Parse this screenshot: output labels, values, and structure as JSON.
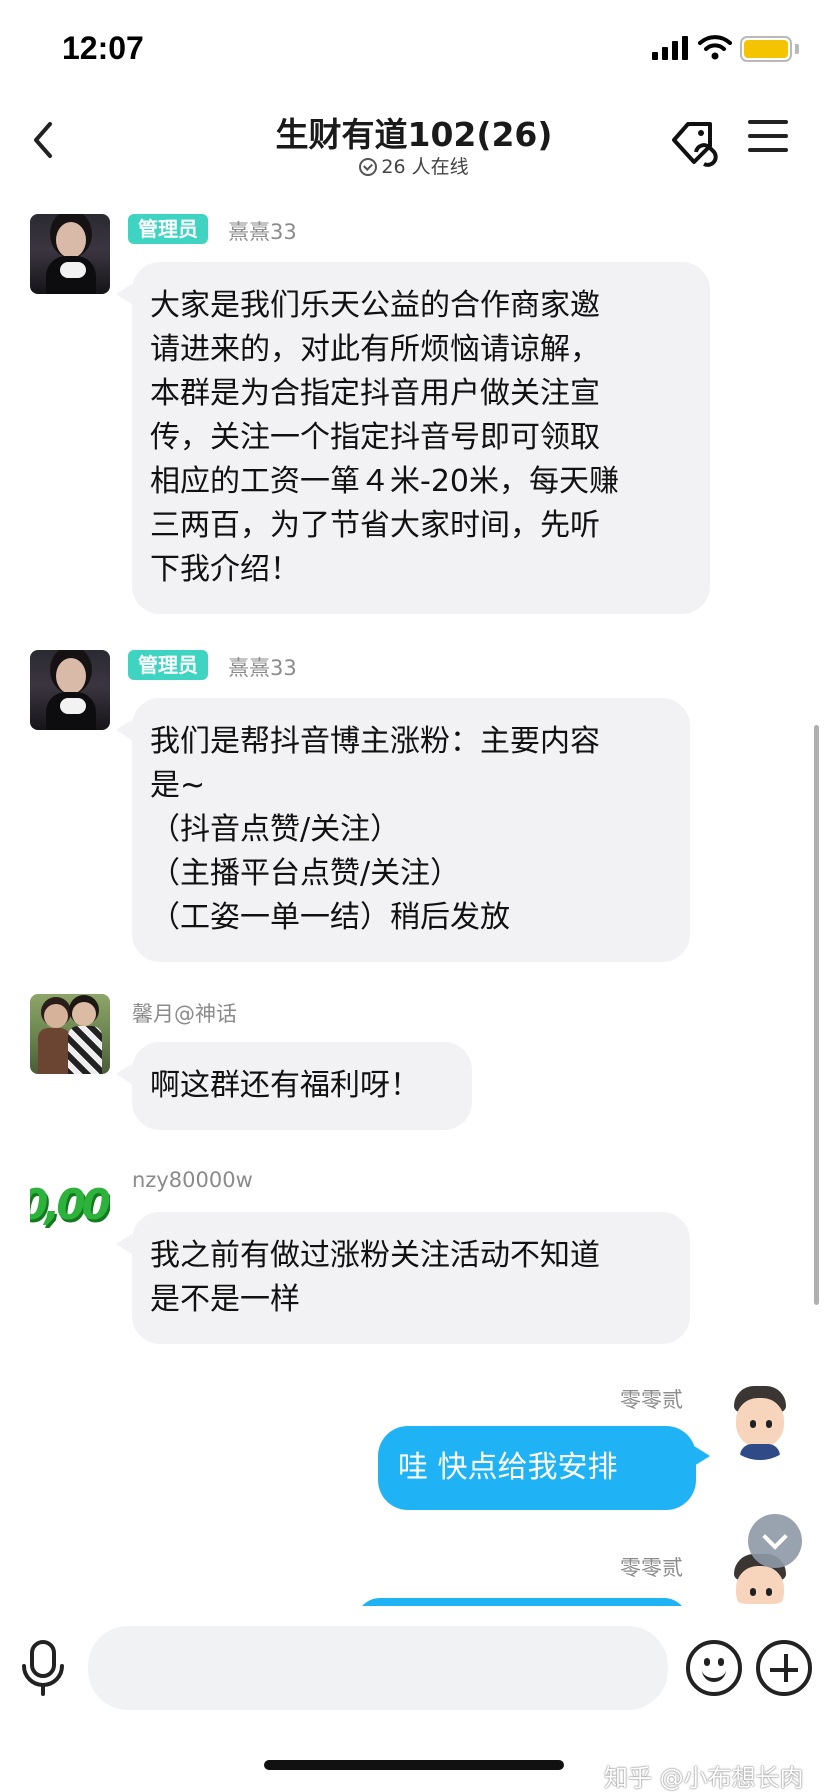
{
  "status_bar": {
    "time": "12:07",
    "battery_color": "#f5c400"
  },
  "header": {
    "title": "生财有道102(26)",
    "online": "26 人在线",
    "back_icon": "chevron-left-icon",
    "tag_icon": "tag-link-icon",
    "menu_icon": "hamburger-menu-icon"
  },
  "messages": [
    {
      "side": "left",
      "badge": "管理员",
      "sender": "熹熹33",
      "lines": [
        "大家是我们乐天公益的合作商家邀",
        "请进来的，对此有所烦恼请谅解，",
        "本群是为合指定抖音用户做关注宣",
        "传，关注一个指定抖音号即可领取",
        "相应的工资一箪４米-20米，每天赚",
        "三两百，为了节省大家时间，先听",
        "下我介绍！"
      ]
    },
    {
      "side": "left",
      "badge": "管理员",
      "sender": "熹熹33",
      "lines": [
        "我们是帮抖音博主涨粉：主要内容",
        "是~",
        "（抖音点赞/关注）",
        "（主播平台点赞/关注）",
        "（工姿一单一结）稍后发放"
      ]
    },
    {
      "side": "left",
      "sender": "馨月@神话",
      "lines": [
        "啊这群还有福利呀！"
      ]
    },
    {
      "side": "left",
      "sender": "nzy80000w",
      "avatar_text": "0,00",
      "lines": [
        "我之前有做过涨粉关注活动不知道",
        "是不是一样"
      ]
    },
    {
      "side": "right",
      "sender": "零零贰",
      "lines": [
        "哇  快点给我安排"
      ]
    },
    {
      "side": "right",
      "sender": "零零贰",
      "lines": []
    }
  ],
  "input": {
    "placeholder": "",
    "value": ""
  },
  "colors": {
    "accent": "#1fb3f5",
    "badge": "#3fd3c1",
    "bubble_other": "#f2f2f5"
  },
  "watermark": "知乎 @小布想长肉"
}
